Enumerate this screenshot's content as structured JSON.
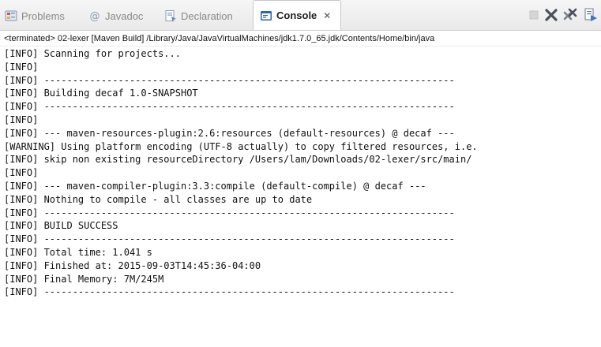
{
  "tabs": [
    {
      "label": "Problems",
      "icon": "problems-icon",
      "active": false
    },
    {
      "label": "Javadoc",
      "icon": "javadoc-icon",
      "active": false
    },
    {
      "label": "Declaration",
      "icon": "declaration-icon",
      "active": false
    },
    {
      "label": "Console",
      "icon": "console-icon",
      "active": true,
      "close_glyph": "✕"
    }
  ],
  "toolbar": {
    "icons": [
      "terminate-icon",
      "remove-launch-icon",
      "remove-all-terminated-icon",
      "console-options-icon"
    ]
  },
  "status_line": "<terminated> 02-lexer [Maven Build] /Library/Java/JavaVirtualMachines/jdk1.7.0_65.jdk/Contents/Home/bin/java",
  "console_lines": [
    "[INFO] Scanning for projects...",
    "[INFO]",
    "[INFO] ------------------------------------------------------------------------",
    "[INFO] Building decaf 1.0-SNAPSHOT",
    "[INFO] ------------------------------------------------------------------------",
    "[INFO]",
    "[INFO] --- maven-resources-plugin:2.6:resources (default-resources) @ decaf ---",
    "[WARNING] Using platform encoding (UTF-8 actually) to copy filtered resources, i.e.",
    "[INFO] skip non existing resourceDirectory /Users/lam/Downloads/02-lexer/src/main/",
    "[INFO]",
    "[INFO] --- maven-compiler-plugin:3.3:compile (default-compile) @ decaf ---",
    "[INFO] Nothing to compile - all classes are up to date",
    "[INFO] ------------------------------------------------------------------------",
    "[INFO] BUILD SUCCESS",
    "[INFO] ------------------------------------------------------------------------",
    "[INFO] Total time: 1.041 s",
    "[INFO] Finished at: 2015-09-03T14:45:36-04:00",
    "[INFO] Final Memory: 7M/245M",
    "[INFO] ------------------------------------------------------------------------"
  ]
}
